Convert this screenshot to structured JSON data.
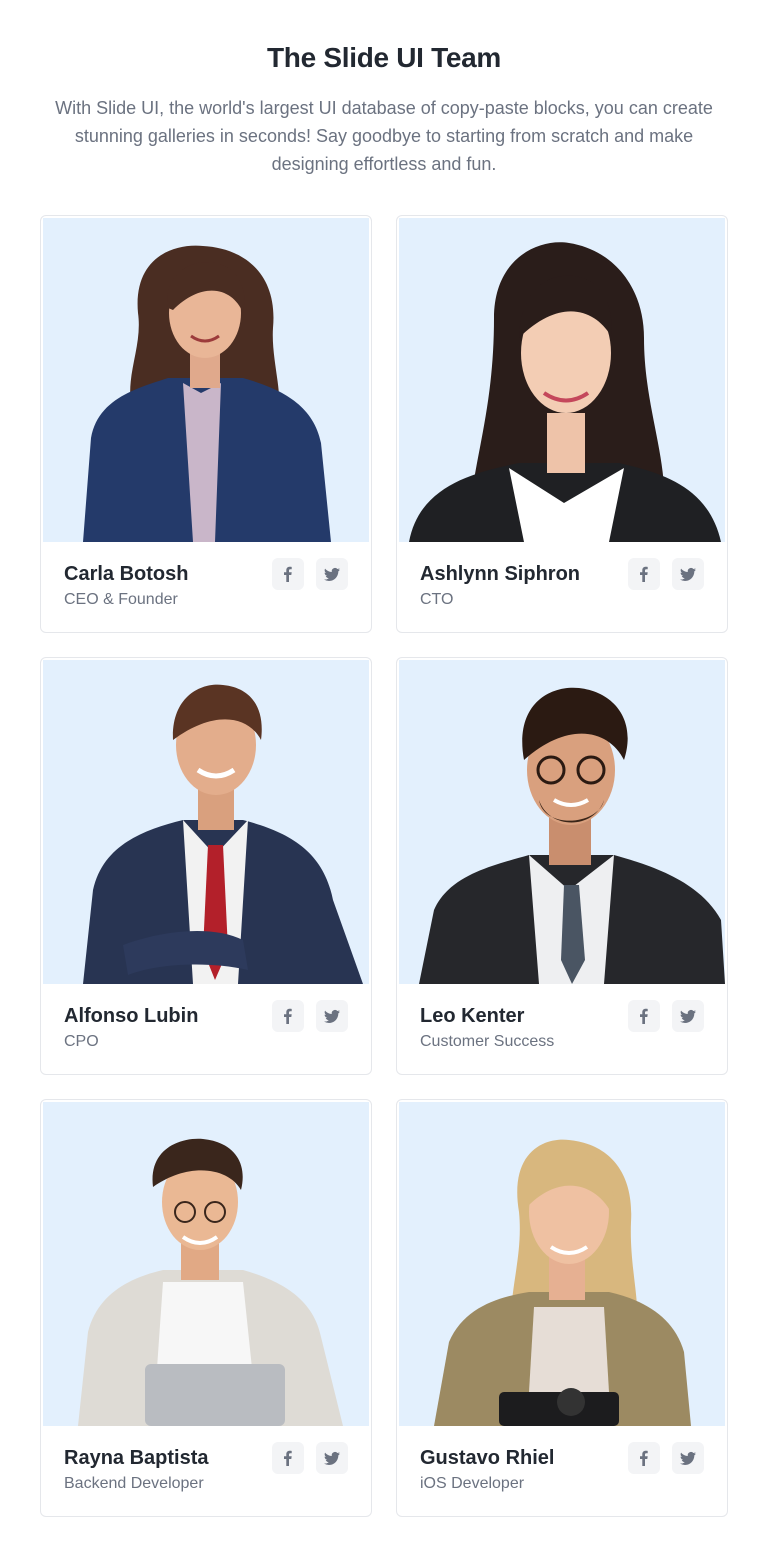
{
  "header": {
    "title": "The Slide UI Team",
    "subtitle": "With Slide UI, the world's largest UI database of copy-paste blocks, you can create stunning galleries in seconds! Say goodbye to starting from scratch and make designing effortless and fun."
  },
  "team": [
    {
      "name": "Carla Botosh",
      "role": "CEO & Founder"
    },
    {
      "name": "Ashlynn Siphron",
      "role": "CTO"
    },
    {
      "name": "Alfonso Lubin",
      "role": "CPO"
    },
    {
      "name": "Leo Kenter",
      "role": "Customer Success"
    },
    {
      "name": "Rayna Baptista",
      "role": "Backend Developer"
    },
    {
      "name": "Gustavo Rhiel",
      "role": "iOS Developer"
    }
  ],
  "social_icons": [
    "facebook-icon",
    "twitter-icon"
  ],
  "colors": {
    "photo_bg": "#e3f0fd",
    "title": "#222831",
    "muted": "#6b7280",
    "icon_bg": "#f3f4f6"
  }
}
